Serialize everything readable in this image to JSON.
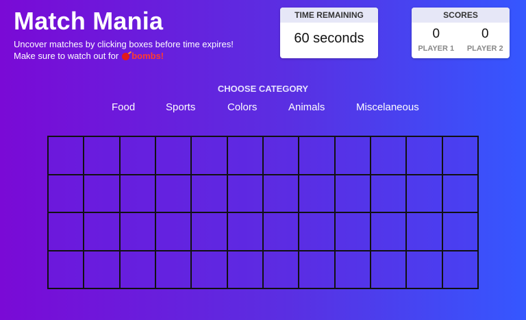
{
  "header": {
    "title": "Match Mania",
    "subtitle_line1": "Uncover matches by clicking boxes before time expires!",
    "subtitle_line2_prefix": "Make sure to watch out for",
    "bomb_icon": "bomb-icon",
    "bombs_text": "bombs!"
  },
  "timer": {
    "label": "TIME REMAINING",
    "value": "60 seconds"
  },
  "scores": {
    "label": "SCORES",
    "players": [
      {
        "score": "0",
        "label": "PLAYER 1"
      },
      {
        "score": "0",
        "label": "PLAYER 2"
      }
    ]
  },
  "category": {
    "heading": "CHOOSE CATEGORY",
    "options": [
      "Food",
      "Sports",
      "Colors",
      "Animals",
      "Miscelaneous"
    ]
  },
  "board": {
    "rows": 4,
    "cols": 12
  },
  "colors": {
    "gradient_start": "#7a0ad6",
    "gradient_end": "#3557ff",
    "bomb": "#ff3b2f"
  }
}
